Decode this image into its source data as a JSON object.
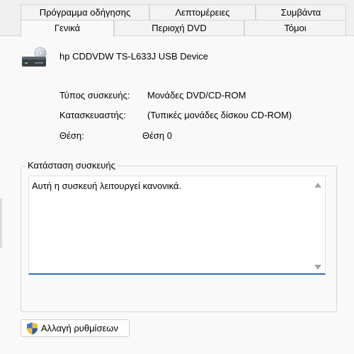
{
  "tabs_back": [
    "Πρόγραμμα οδήγησης",
    "Λεπτομέρειες",
    "Συμβάντα"
  ],
  "tabs_front": [
    "Γενικά",
    "Περιοχή DVD",
    "Τόμοι"
  ],
  "active_tab": "Γενικά",
  "device": {
    "name": "hp CDDVDW TS-L633J USB Device",
    "icon": "dvd-drive-icon"
  },
  "properties": [
    {
      "label": "Τύπος συσκευής:",
      "value": "Μονάδες DVD/CD-ROM"
    },
    {
      "label": "Κατασκευαστής:",
      "value": "(Τυπικές μονάδες δίσκου CD-ROM)"
    },
    {
      "label": "Θέση:",
      "value": "Θέση 0"
    }
  ],
  "status_group": {
    "title": "Κατάσταση συσκευής",
    "text": "Αυτή η συσκευή λειτουργεί κανονικά."
  },
  "change_settings_button": {
    "label": "Αλλαγή ρυθμίσεων",
    "icon": "uac-shield-icon"
  },
  "colors": {
    "accent": "#2f6fb7",
    "window_bg": "#f0f0f0",
    "panel_bg": "#f9f9f9"
  }
}
